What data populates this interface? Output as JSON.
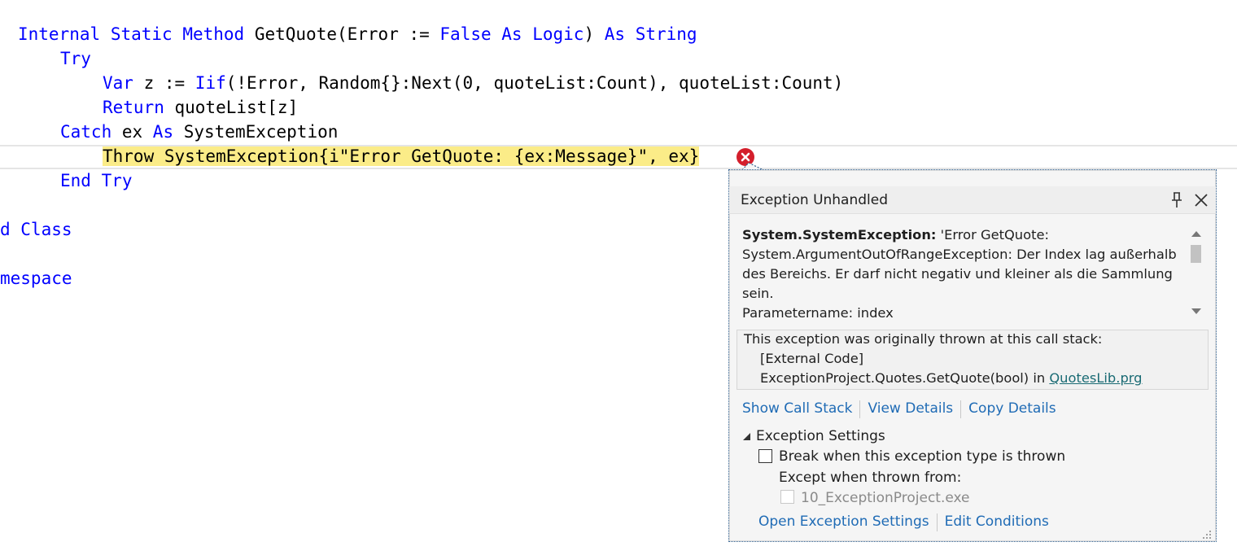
{
  "editor": {
    "lines": [
      {
        "tokens": [
          {
            "t": "Internal",
            "k": 1
          },
          {
            "t": " "
          },
          {
            "t": "Static",
            "k": 1
          },
          {
            "t": " "
          },
          {
            "t": "Method",
            "k": 1
          },
          {
            "t": " GetQuote(Error := "
          },
          {
            "t": "False",
            "k": 1
          },
          {
            "t": " "
          },
          {
            "t": "As",
            "k": 1
          },
          {
            "t": " "
          },
          {
            "t": "Logic",
            "k": 1
          },
          {
            "t": ") "
          },
          {
            "t": "As",
            "k": 1
          },
          {
            "t": " "
          },
          {
            "t": "String",
            "k": 1
          }
        ]
      },
      {
        "tokens": [
          {
            "t": "Try",
            "k": 1
          }
        ]
      },
      {
        "tokens": [
          {
            "t": "Var",
            "k": 1
          },
          {
            "t": " z := "
          },
          {
            "t": "Iif",
            "k": 1
          },
          {
            "t": "(!Error, Random{}:Next(0, quoteList:Count), quoteList:Count)"
          }
        ]
      },
      {
        "tokens": [
          {
            "t": "Return",
            "k": 1
          },
          {
            "t": " quoteList[z]"
          }
        ]
      },
      {
        "tokens": [
          {
            "t": "Catch",
            "k": 1
          },
          {
            "t": " ex "
          },
          {
            "t": "As",
            "k": 1
          },
          {
            "t": " SystemException"
          }
        ]
      },
      {
        "tokens": [
          {
            "t": "Throw SystemException{i\"Error GetQuote: {ex:Message}\", ex}",
            "h": 1
          }
        ]
      },
      {
        "tokens": [
          {
            "t": "End",
            "k": 1
          },
          {
            "t": " "
          },
          {
            "t": "Try",
            "k": 1
          }
        ]
      },
      {
        "tokens": []
      },
      {
        "tokens": [
          {
            "t": "d Class",
            "k": 1
          }
        ]
      },
      {
        "tokens": []
      },
      {
        "tokens": [
          {
            "t": "mespace",
            "k": 1
          }
        ]
      }
    ]
  },
  "popup": {
    "title": "Exception Unhandled",
    "message_type": "System.SystemException:",
    "message_line1_rest": "'Error GetQuote:",
    "message_line2": "System.ArgumentOutOfRangeException: Der Index lag außerhalb",
    "message_line3": "des Bereichs. Er darf nicht negativ und kleiner als die Sammlung",
    "message_line4": "sein.",
    "message_line5": "Parametername: index",
    "stack_intro": "This exception was originally thrown at this call stack:",
    "stack_external": "[External Code]",
    "stack_frame_text": "ExceptionProject.Quotes.GetQuote(bool) in ",
    "stack_frame_file": "QuotesLib.prg",
    "link_show_call_stack": "Show Call Stack",
    "link_view_details": "View Details",
    "link_copy_details": "Copy Details",
    "settings_heading": "Exception Settings",
    "break_label": "Break when this exception type is thrown",
    "break_checked": false,
    "except_label": "Except when thrown from:",
    "exe_label": "10_ExceptionProject.exe",
    "exe_checked": false,
    "link_open_settings": "Open Exception Settings",
    "link_edit_conditions": "Edit Conditions"
  },
  "colors": {
    "keyword": "#0000ff",
    "highlight": "#fbec88",
    "error": "#d41f2c",
    "link": "#1f6bb5",
    "file_link": "#1a6b74"
  }
}
